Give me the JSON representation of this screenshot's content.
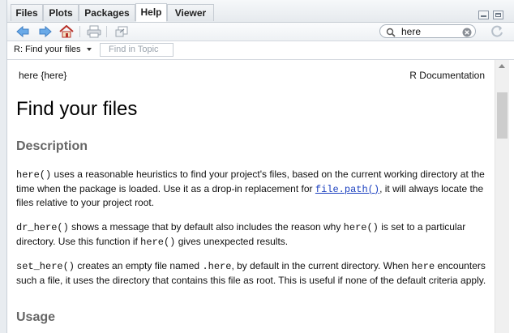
{
  "tabs": [
    {
      "label": "Files"
    },
    {
      "label": "Plots"
    },
    {
      "label": "Packages"
    },
    {
      "label": "Help"
    },
    {
      "label": "Viewer"
    }
  ],
  "toolbar": {
    "search_value": "here",
    "icons": [
      "back-arrow-icon",
      "forward-arrow-icon",
      "home-icon",
      "print-icon",
      "open-in-new-window-icon",
      "refresh-icon"
    ]
  },
  "subbar": {
    "topic_selector": "R: Find your files",
    "find_in_topic_placeholder": "Find in Topic"
  },
  "doc": {
    "package_label": "here {here}",
    "doc_label": "R Documentation",
    "title": "Find your files",
    "description_heading": "Description",
    "p1_code1": "here()",
    "p1_text1": " uses a reasonable heuristics to find your project's files, based on the current working directory at the time when the package is loaded. Use it as a drop-in replacement for ",
    "p1_link": "file.path()",
    "p1_text2": ", it will always locate the files relative to your project root.",
    "p2_code1": "dr_here()",
    "p2_text1": " shows a message that by default also includes the reason why ",
    "p2_code2": "here()",
    "p2_text2": " is set to a particular directory. Use this function if ",
    "p2_code3": "here()",
    "p2_text3": " gives unexpected results.",
    "p3_code1": "set_here()",
    "p3_text1": " creates an empty file named ",
    "p3_code2": ".here",
    "p3_text2": ", by default in the current directory. When ",
    "p3_code3": "here",
    "p3_text3": " encounters such a file, it uses the directory that contains this file as root. This is useful if none of the default criteria apply.",
    "usage_heading": "Usage"
  },
  "colors": {
    "link": "#1a3fbf",
    "heading_gray": "#666666",
    "home_icon": "#c0392b",
    "nav_arrow": "#4a8fd6"
  }
}
